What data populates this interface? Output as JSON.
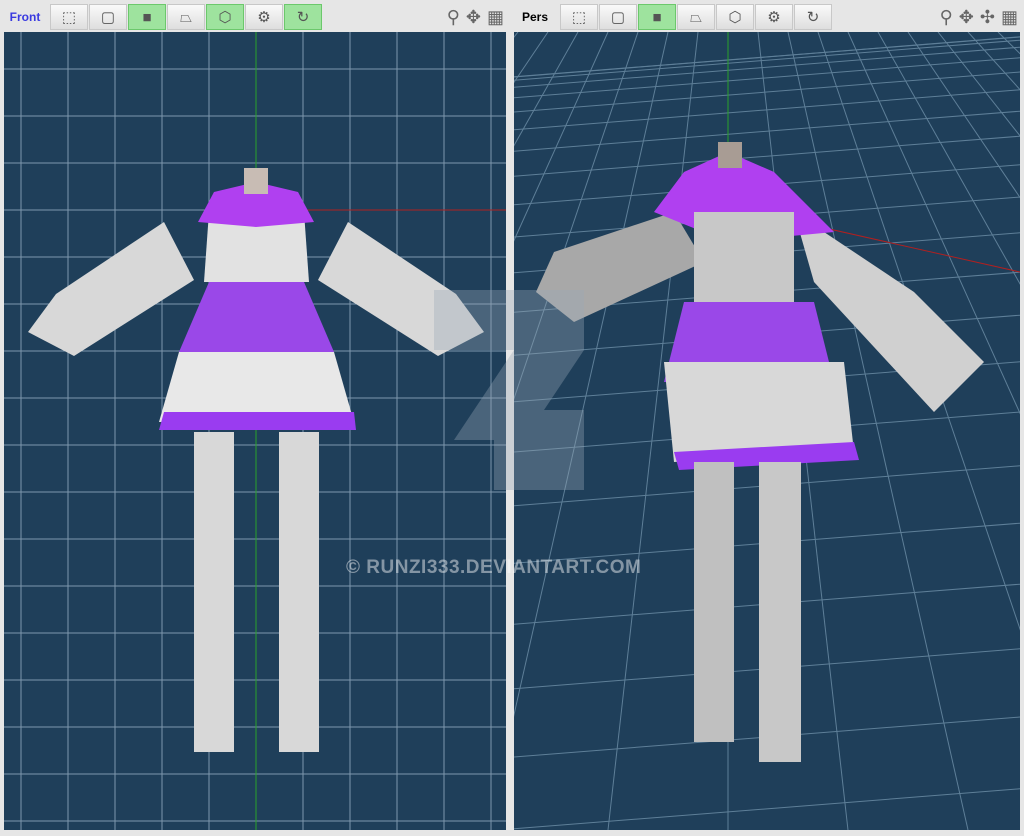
{
  "views": [
    {
      "label": "Front",
      "buttons": [
        {
          "icon": "select-rect-icon",
          "active": false
        },
        {
          "icon": "frame-icon",
          "active": false
        },
        {
          "icon": "solid-icon",
          "active": true
        },
        {
          "icon": "texture-icon",
          "active": false
        },
        {
          "icon": "wireframe-cube-icon",
          "active": true
        },
        {
          "icon": "gear-icon",
          "active": false
        },
        {
          "icon": "refresh-icon",
          "active": true
        }
      ]
    },
    {
      "label": "Pers",
      "buttons": [
        {
          "icon": "select-rect-icon",
          "active": false
        },
        {
          "icon": "frame-icon",
          "active": false
        },
        {
          "icon": "solid-icon",
          "active": true
        },
        {
          "icon": "texture-icon",
          "active": false
        },
        {
          "icon": "wireframe-cube-icon",
          "active": false
        },
        {
          "icon": "gear-icon",
          "active": false
        },
        {
          "icon": "refresh-icon",
          "active": false
        }
      ]
    }
  ],
  "icons": {
    "select-rect-icon": "⬚",
    "frame-icon": "▢",
    "solid-icon": "■",
    "texture-icon": "⏢",
    "wireframe-cube-icon": "⬡",
    "gear-icon": "⚙",
    "refresh-icon": "↻",
    "zoom": "🔍",
    "move": "✥",
    "rotate": "✣",
    "display": "▦"
  },
  "watermark": "© RUNZI333.DEVIANTART.COM",
  "colors": {
    "viewport": "#1f3f5a",
    "grid": "#6f8ca3",
    "purple": "#9a3cf0",
    "white": "#e0e0e0"
  }
}
